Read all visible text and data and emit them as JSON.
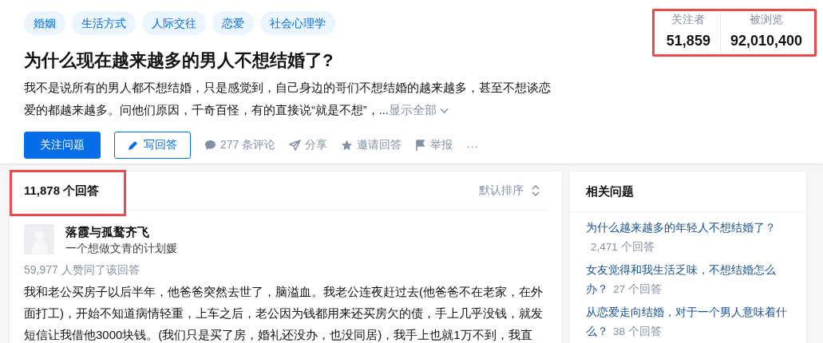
{
  "topics": [
    {
      "label": "婚姻"
    },
    {
      "label": "生活方式"
    },
    {
      "label": "人际交往"
    },
    {
      "label": "恋爱"
    },
    {
      "label": "社会心理学"
    }
  ],
  "question": {
    "title": "为什么现在越来越多的男人不想结婚了?",
    "excerpt": "我不是说所有的男人都不想结婚，只是感觉到，自己身边的哥们不想结婚的越来越多，甚至不想谈恋爱的都越来越多。问他们原因，千奇百怪，有的直接说“就是不想”，...",
    "show_all": "显示全部"
  },
  "stats": {
    "highlighted": true,
    "items": [
      {
        "label": "关注者",
        "value": "51,859"
      },
      {
        "label": "被浏览",
        "value": "92,010,400"
      }
    ]
  },
  "actions": [
    {
      "kind": "primary",
      "label": "关注问题"
    },
    {
      "kind": "outline",
      "label": "写回答"
    },
    {
      "kind": "plain",
      "label": "277 条评论"
    },
    {
      "kind": "plain",
      "label": "分享"
    },
    {
      "kind": "plain",
      "label": "邀请回答"
    },
    {
      "kind": "plain",
      "label": "举报"
    },
    {
      "kind": "more",
      "label": "···"
    }
  ],
  "answers": {
    "count": "11,878 个回答",
    "highlighted": true,
    "sort": "默认排序",
    "author": {
      "name": "落霞与孤鹜齐飞",
      "headline": "一个想做文青的计划媛"
    },
    "votes": "59,977 人赞同了该回答",
    "content": "我和老公买房子以后半年，他爸爸突然去世了，脑溢血。我老公连夜赶过去(他爸爸不在老家，在外面打工)，开始不知道病情轻重，上车之后，老公因为钱都用来还买房欠的债，手上几乎没钱，就发短信让我借他3000块钱。(我们只是买了房，婚礼还没办，也没同居)，我手上也就1万不到，我直"
  },
  "related": {
    "title": "相关问题",
    "items": [
      {
        "title": "为什么越来越多的年轻人不想结婚了？",
        "answers": "2,471 个回答"
      },
      {
        "title": "女友觉得和我生活乏味，不想结婚怎么办？",
        "answers": "27 个回答"
      },
      {
        "title": "从恋爱走向结婚，对于一个男人意味着什么？",
        "answers": "38 个回答"
      }
    ]
  }
}
